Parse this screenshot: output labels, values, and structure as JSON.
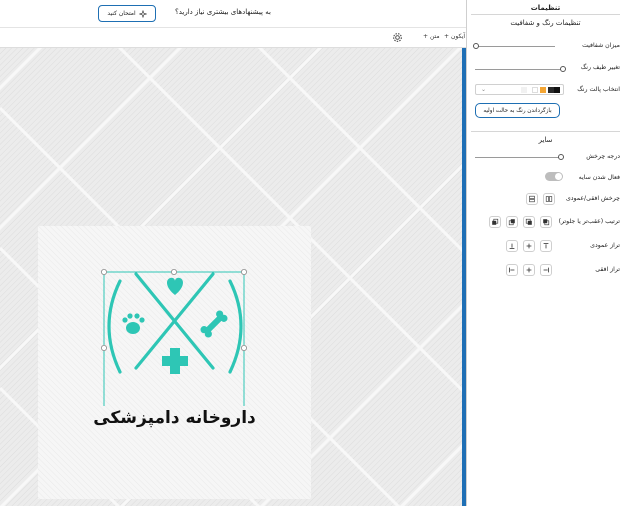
{
  "topbar": {
    "suggest_text": "به پیشنهادهای بیشتری نیاز دارید؟",
    "try_button": "امتحان کنید"
  },
  "toolbar": {
    "add_icon": "+ آیکون",
    "add_text": "+ متن",
    "settings_icon": "gear-icon"
  },
  "canvas": {
    "brand_text": "داروخانه دامپزشکی",
    "accent_color": "#2ec6b5"
  },
  "panel": {
    "title": "تنظیمات",
    "color_section": "تنظیمات رنگ و شفافیت",
    "opacity_label": "میزان شفافیت",
    "hue_label": "تغییر طیف رنگ",
    "palette_label": "انتخاب پالت رنگ",
    "palette_colors": [
      "#111111",
      "#222222",
      "#f4a533",
      "#ffffff",
      "#eeeeee"
    ],
    "reset_button": "بازگرداندن رنگ به حالت اولیه",
    "other_section": "سایر",
    "rotation_label": "درجه چرخش",
    "shadow_label": "فعال شدن سایه",
    "flip_label": "چرخش افقی/عمودی",
    "order_label": "ترتیب (عقب‌تر یا جلوتر)",
    "valign_label": "تراز عمودی",
    "halign_label": "تراز افقی",
    "brand_color": "#1e6fb3"
  }
}
